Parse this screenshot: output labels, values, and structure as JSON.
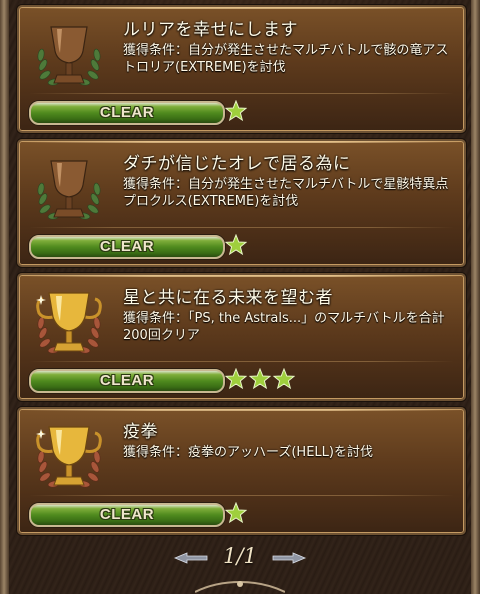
{
  "trophies": [
    {
      "title": "ルリアを幸せにします",
      "condition": "獲得条件：自分が発生させたマルチバトルで骸の竜アストロリア(EXTREME)を討伐",
      "status": "CLEAR",
      "stars": 1,
      "trophy_tier": "bronze",
      "trophy_icon": "bronze-trophy-icon"
    },
    {
      "title": "ダチが信じたオレで居る為に",
      "condition": "獲得条件：自分が発生させたマルチバトルで星骸特異点プロクルス(EXTREME)を討伐",
      "status": "CLEAR",
      "stars": 1,
      "trophy_tier": "bronze",
      "trophy_icon": "bronze-trophy-icon"
    },
    {
      "title": "星と共に在る未来を望む者",
      "condition": "獲得条件：「PS, the Astrals...」のマルチバトルを合計200回クリア",
      "status": "CLEAR",
      "stars": 3,
      "trophy_tier": "gold",
      "trophy_icon": "gold-trophy-icon"
    },
    {
      "title": "疫拳",
      "condition": "獲得条件：疫拳のアッハーズ(HELL)を討伐",
      "status": "CLEAR",
      "stars": 1,
      "trophy_tier": "gold",
      "trophy_icon": "gold-trophy-icon"
    }
  ],
  "pager": {
    "label": "1/1"
  },
  "colors": {
    "bronze": "#8a5a32",
    "gold": "#e7b73c",
    "star": "#9fcf3d",
    "clear_bar": "#4f8a1e"
  }
}
